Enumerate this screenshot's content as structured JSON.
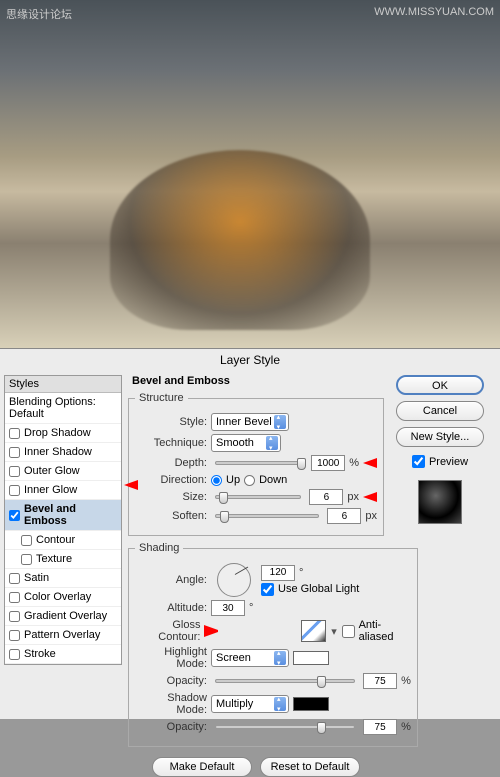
{
  "watermark": {
    "left": "思缘设计论坛",
    "right": "WWW.MISSYUAN.COM"
  },
  "dialog": {
    "title": "Layer Style"
  },
  "sidebar": {
    "header": "Styles",
    "blending": "Blending Options: Default",
    "items": [
      {
        "label": "Drop Shadow",
        "checked": false
      },
      {
        "label": "Inner Shadow",
        "checked": false
      },
      {
        "label": "Outer Glow",
        "checked": false
      },
      {
        "label": "Inner Glow",
        "checked": false
      },
      {
        "label": "Bevel and Emboss",
        "checked": true,
        "selected": true
      },
      {
        "label": "Contour",
        "checked": false,
        "sub": true
      },
      {
        "label": "Texture",
        "checked": false,
        "sub": true
      },
      {
        "label": "Satin",
        "checked": false
      },
      {
        "label": "Color Overlay",
        "checked": false
      },
      {
        "label": "Gradient Overlay",
        "checked": false
      },
      {
        "label": "Pattern Overlay",
        "checked": false
      },
      {
        "label": "Stroke",
        "checked": false
      }
    ]
  },
  "bevel": {
    "heading": "Bevel and Emboss",
    "structure": {
      "legend": "Structure",
      "style_label": "Style:",
      "style_value": "Inner Bevel",
      "technique_label": "Technique:",
      "technique_value": "Smooth",
      "depth_label": "Depth:",
      "depth_value": "1000",
      "depth_unit": "%",
      "direction_label": "Direction:",
      "up": "Up",
      "down": "Down",
      "size_label": "Size:",
      "size_value": "6",
      "size_unit": "px",
      "soften_label": "Soften:",
      "soften_value": "6",
      "soften_unit": "px"
    },
    "shading": {
      "legend": "Shading",
      "angle_label": "Angle:",
      "angle_value": "120",
      "angle_unit": "°",
      "global_light": "Use Global Light",
      "altitude_label": "Altitude:",
      "altitude_value": "30",
      "altitude_unit": "°",
      "gloss_label": "Gloss Contour:",
      "antialias": "Anti-aliased",
      "highlight_label": "Highlight Mode:",
      "highlight_value": "Screen",
      "hl_opacity_label": "Opacity:",
      "hl_opacity_value": "75",
      "pct": "%",
      "shadow_label": "Shadow Mode:",
      "shadow_value": "Multiply",
      "sh_opacity_label": "Opacity:",
      "sh_opacity_value": "75"
    }
  },
  "buttons": {
    "ok": "OK",
    "cancel": "Cancel",
    "newstyle": "New Style...",
    "preview": "Preview",
    "make_default": "Make Default",
    "reset_default": "Reset to Default"
  }
}
